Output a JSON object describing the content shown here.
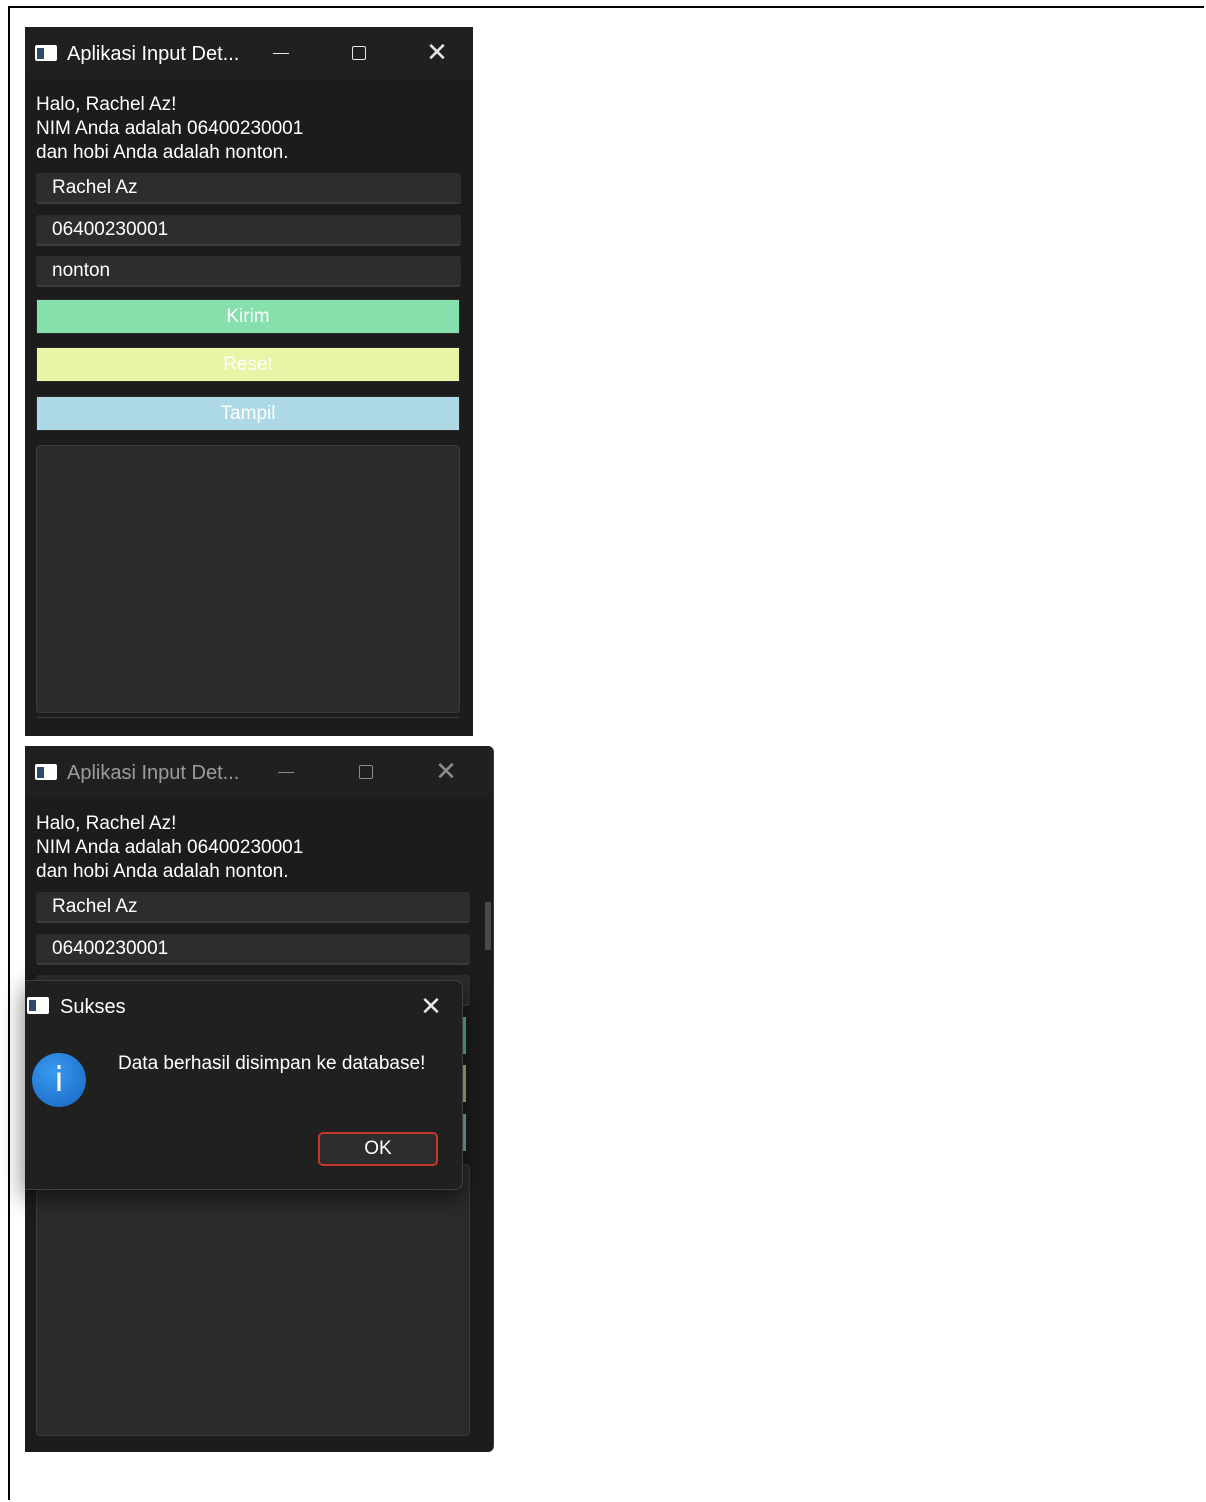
{
  "window": {
    "title": "Aplikasi Input Det...",
    "controls": {
      "minimize": "—",
      "maximize": "☐",
      "close": "✕"
    }
  },
  "greeting": "Halo, Rachel Az!\nNIM Anda adalah 06400230001\ndan hobi Anda adalah nonton.",
  "form": {
    "nama": "Rachel Az",
    "nim": "06400230001",
    "hobi": "nonton"
  },
  "buttons": {
    "kirim": "Kirim",
    "reset": "Reset",
    "tampil": "Tampil"
  },
  "dialog": {
    "title": "Sukses",
    "message": "Data berhasil disimpan ke database!",
    "ok_label": "OK",
    "icon": "info-icon"
  },
  "colors": {
    "window_bg": "#1c1c1c",
    "kirim": "#85e0ab",
    "reset": "#e6f5a6",
    "tampil": "#add8e6",
    "ok_border": "#c0392b"
  }
}
